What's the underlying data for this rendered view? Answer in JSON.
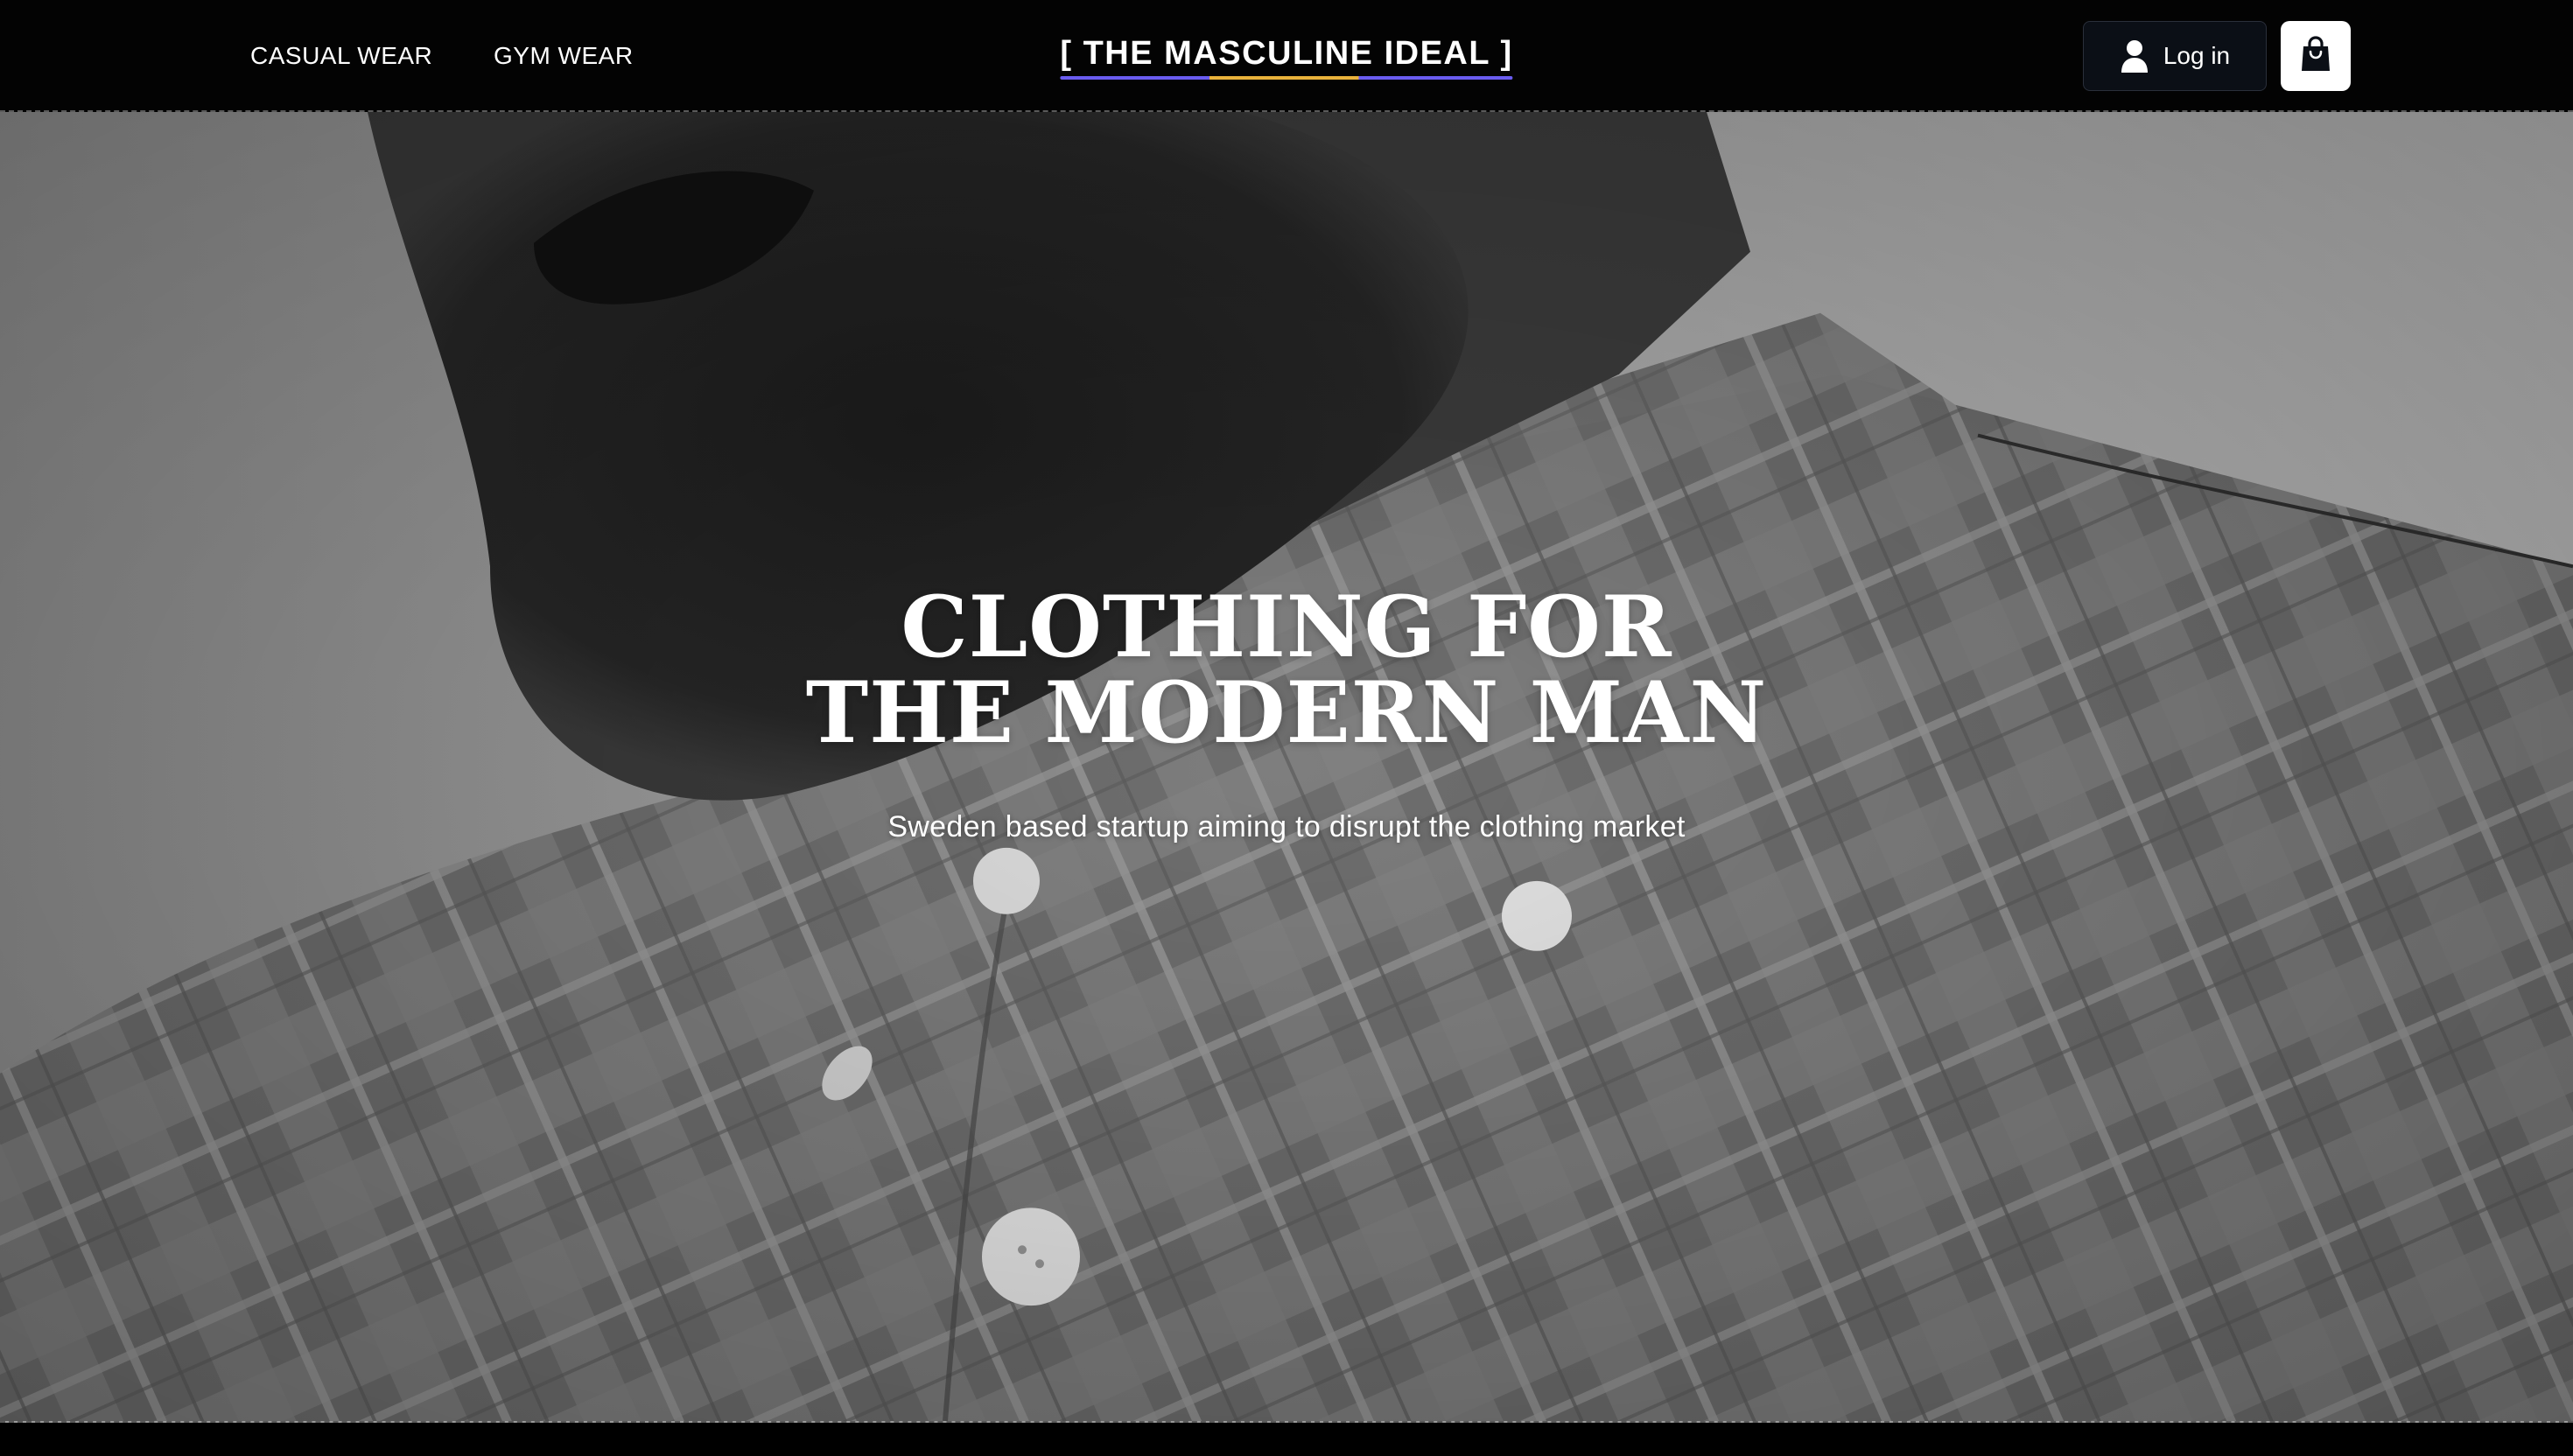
{
  "nav": {
    "links": [
      {
        "label": "CASUAL WEAR"
      },
      {
        "label": "GYM WEAR"
      }
    ],
    "brand": "[ THE MASCULINE IDEAL ]",
    "login_label": "Log in",
    "icons": {
      "login": "user-icon",
      "cart": "shopping-bag-icon"
    }
  },
  "hero": {
    "title_line1": "CLOTHING FOR",
    "title_line2": "THE MODERN MAN",
    "subtitle": "Sweden based startup aiming to disrupt the clothing market",
    "image": "grayscale photo of bearded man in plaid button-down shirt"
  },
  "colors": {
    "nav_bg": "#030303",
    "brand_underline": [
      "#6a5cf0",
      "#e9b23b",
      "#6a5cf0"
    ],
    "login_bg": "#0b0f16",
    "cart_bg": "#ffffff",
    "text": "#ffffff"
  }
}
